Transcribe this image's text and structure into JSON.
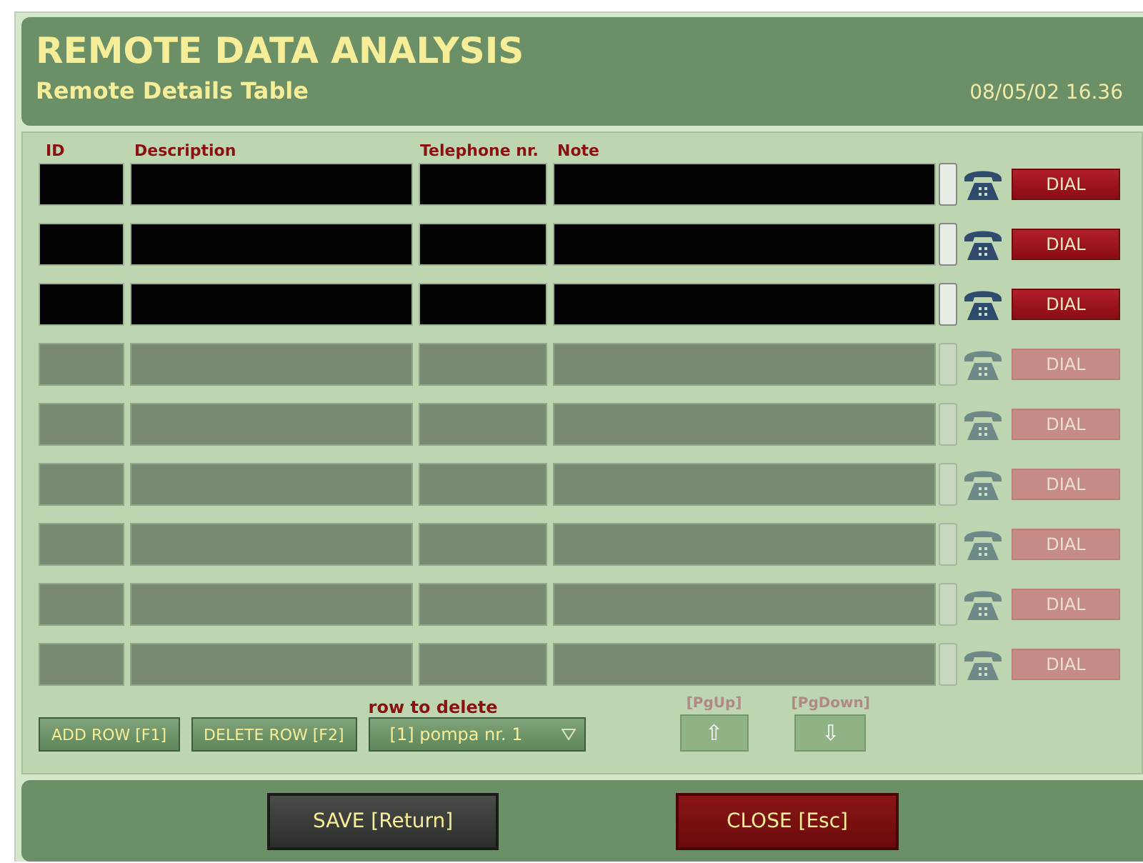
{
  "window": {
    "title": "REMOTE DATA ANALYSIS",
    "subtitle": "Remote Details Table",
    "datetime": "08/05/02 16.36"
  },
  "table": {
    "columns": [
      "ID",
      "Description",
      "Telephone nr.",
      "Note"
    ],
    "rows": [
      {
        "disabled": false,
        "dial": "DIAL"
      },
      {
        "disabled": false,
        "dial": "DIAL"
      },
      {
        "disabled": false,
        "dial": "DIAL"
      },
      {
        "disabled": true,
        "dial": "DIAL"
      },
      {
        "disabled": true,
        "dial": "DIAL"
      },
      {
        "disabled": true,
        "dial": "DIAL"
      },
      {
        "disabled": true,
        "dial": "DIAL"
      },
      {
        "disabled": true,
        "dial": "DIAL"
      },
      {
        "disabled": true,
        "dial": "DIAL"
      }
    ]
  },
  "controls": {
    "add_button": "ADD ROW [F1]",
    "delete_button": "DELETE ROW [F2]",
    "row_to_delete": {
      "label": "row to delete",
      "value": "[1] pompa nr. 1"
    },
    "page_up": {
      "label": "[PgUp]",
      "arrow": "⇧",
      "disabled": true
    },
    "page_down": {
      "label": "[PgDown]",
      "arrow": "⇩",
      "disabled": true
    }
  },
  "footer": {
    "save_button": "SAVE [Return]",
    "close_button": "CLOSE [Esc]"
  }
}
